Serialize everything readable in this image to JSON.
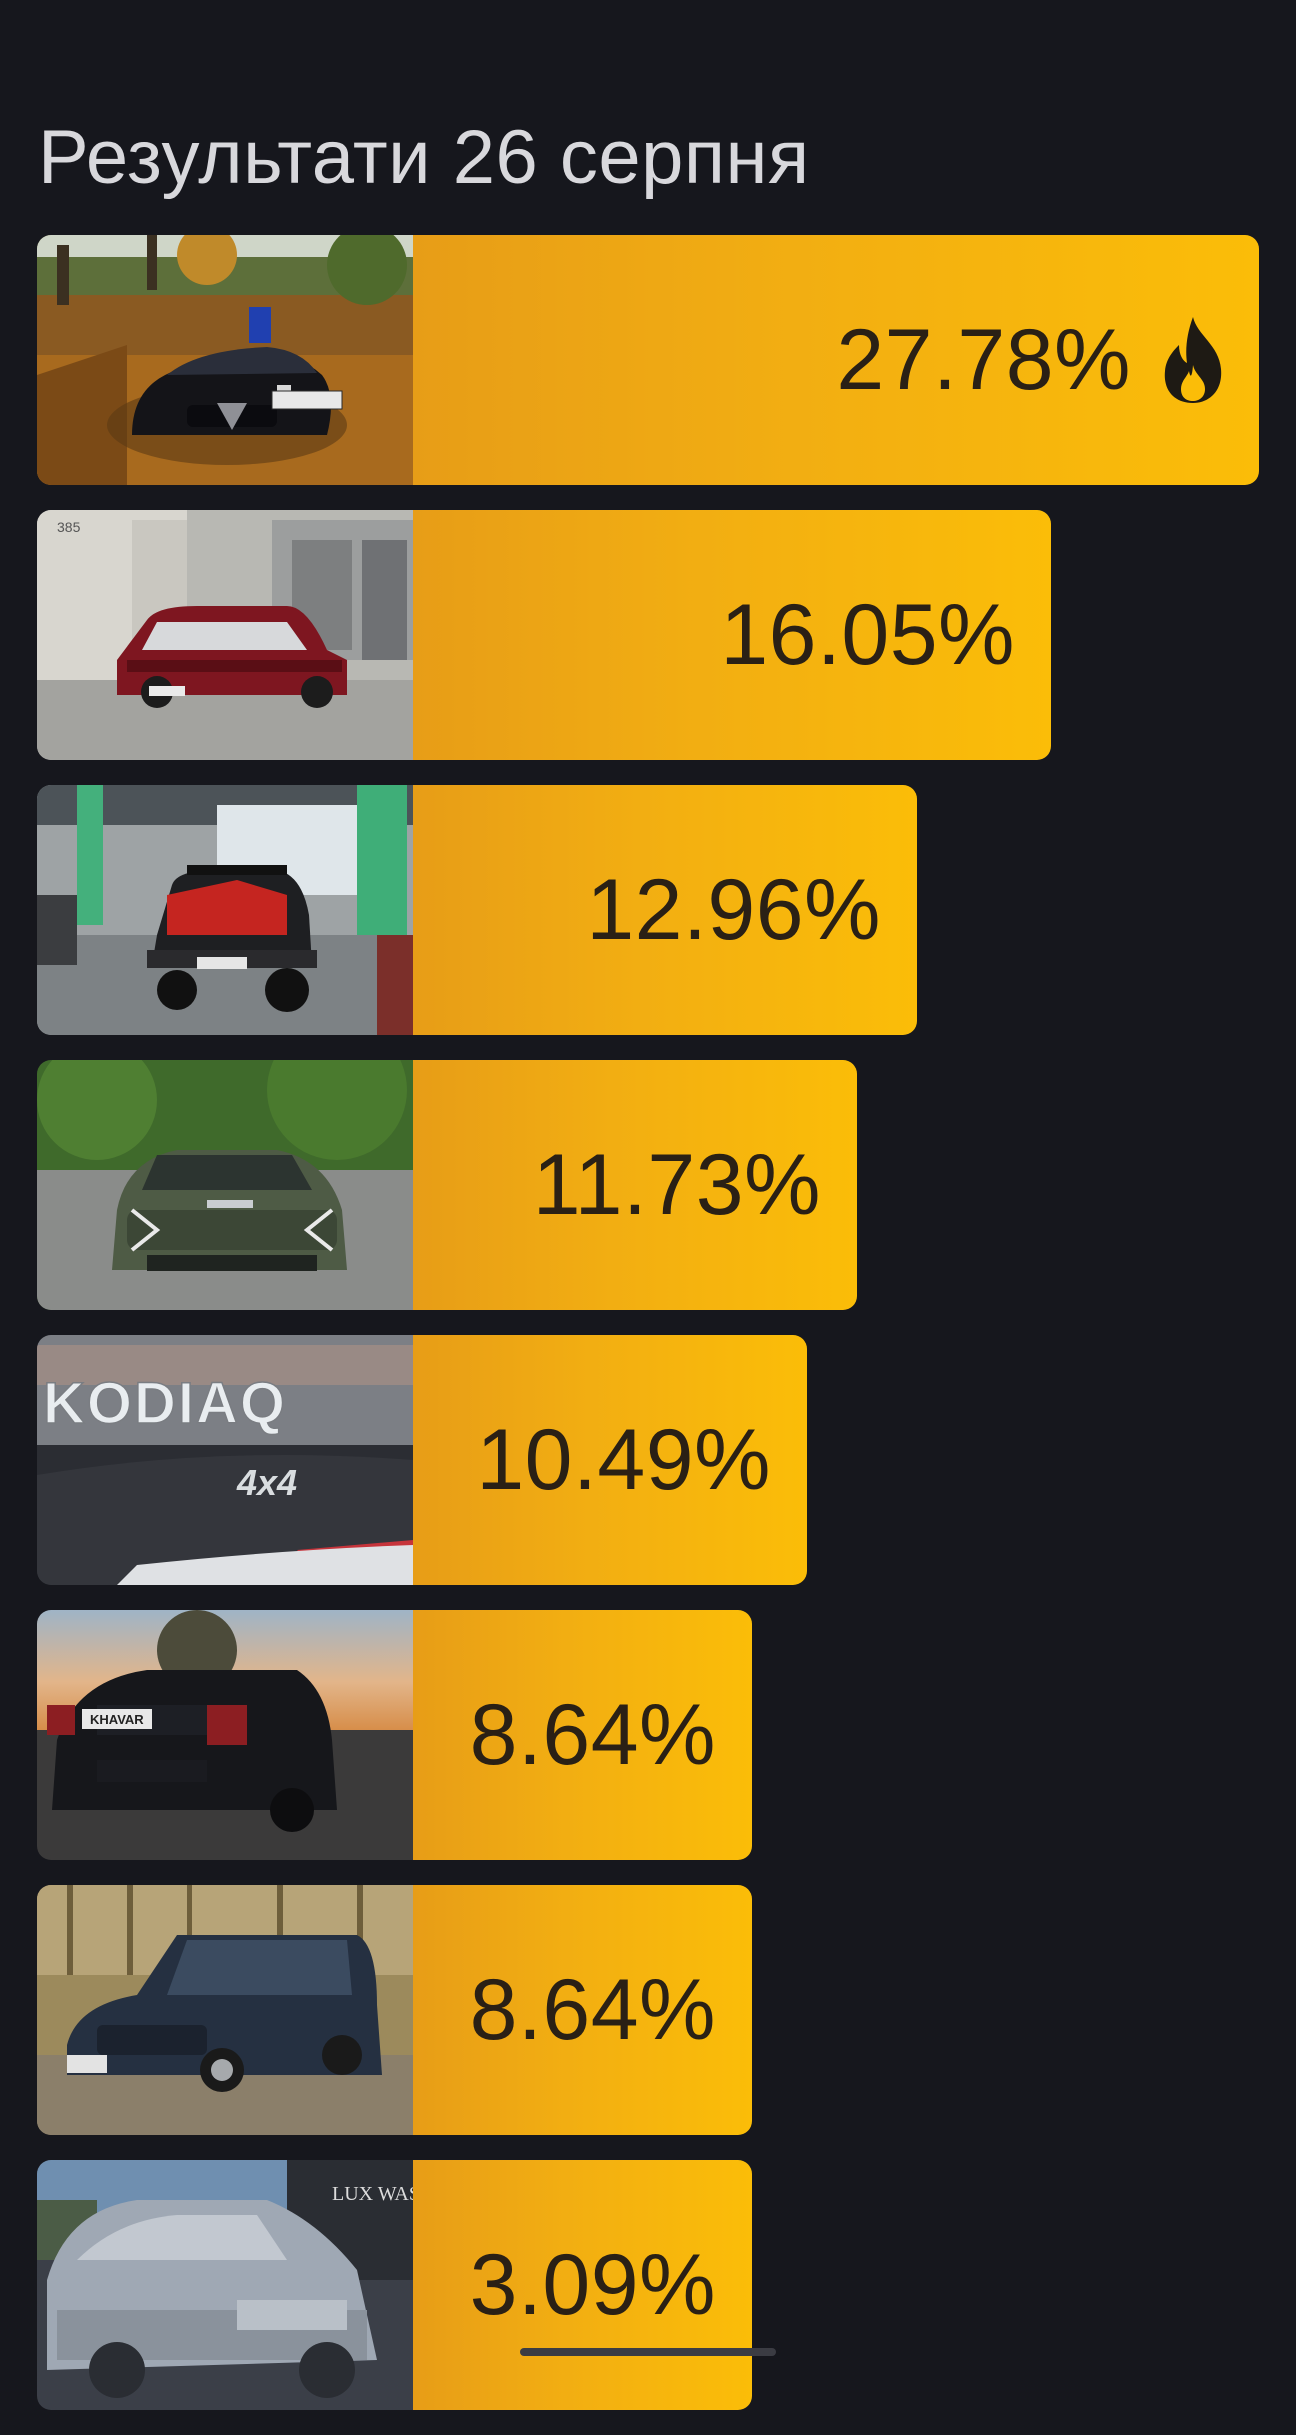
{
  "title": "Результати 26 серпня",
  "results": [
    {
      "percent": "27.78%",
      "value": 27.78,
      "photo": "alfa-romeo-autumn-photo",
      "badge_icon": "fire-icon"
    },
    {
      "percent": "16.05%",
      "value": 16.05,
      "photo": "red-lada-garage-photo"
    },
    {
      "percent": "12.96%",
      "value": 12.96,
      "photo": "red-niva-gas-station-photo"
    },
    {
      "percent": "11.73%",
      "value": 11.73,
      "photo": "green-kia-sportage-photo"
    },
    {
      "percent": "10.49%",
      "value": 10.49,
      "photo": "skoda-kodiaq-badge-photo"
    },
    {
      "percent": "8.64%",
      "value": 8.64,
      "photo": "black-skoda-sunset-photo"
    },
    {
      "percent": "8.64%",
      "value": 8.64,
      "photo": "volvo-wagon-forest-photo"
    },
    {
      "percent": "3.09%",
      "value": 3.09,
      "photo": "foamed-car-wash-photo"
    }
  ],
  "colors": {
    "background": "#16171d",
    "bar_start": "#e79d17",
    "bar_end": "#fbbd08",
    "text": "#2a2015",
    "title": "#d8d8dc"
  }
}
